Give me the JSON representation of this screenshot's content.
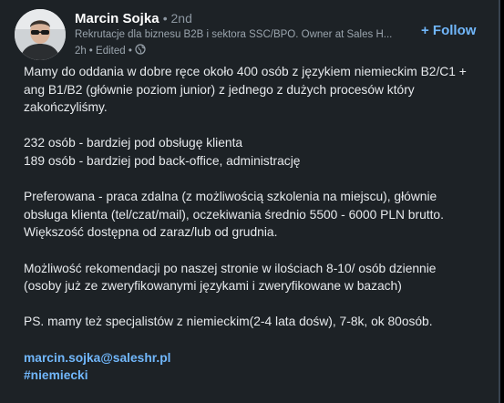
{
  "post": {
    "author": {
      "name": "Marcin Sojka",
      "degree": "• 2nd",
      "headline": "Rekrutacje dla biznesu B2B i sektora SSC/BPO. Owner at Sales H...",
      "time": "2h",
      "edited": "• Edited •",
      "visibility_icon": "globe-icon"
    },
    "follow_label": "+ Follow",
    "lines": {
      "p1_l1": "Mamy do oddania w dobre ręce około 400 osób z językiem niemieckim B2/C1 +",
      "p1_l2": "ang B1/B2 (głównie poziom junior) z jednego z dużych procesów który",
      "p1_l3": "zakończyliśmy.",
      "p2_l1": "232 osób - bardziej pod obsługę klienta",
      "p2_l2": "189 osób - bardziej pod back-office, administrację",
      "p3_l1": "Preferowana - praca zdalna (z możliwością szkolenia na miejscu), głównie",
      "p3_l2": "obsługa klienta (tel/czat/mail), oczekiwania średnio 5500 - 6000 PLN brutto.",
      "p3_l3": "Większość dostępna od zaraz/lub od grudnia.",
      "p4_l1": "Możliwość rekomendacji po naszej stronie w ilościach 8-10/ osób dziennie",
      "p4_l2": "(osoby już ze zweryfikowanymi językami i zweryfikowane w bazach)",
      "p5_l1": "PS. mamy też specjalistów z niemieckim(2-4 lata dośw), 7-8k, ok 80osób."
    },
    "email_link": "marcin.sojka@saleshr.pl",
    "hashtag": "#niemiecki"
  },
  "colors": {
    "background": "#1d2226",
    "text": "#e6e9ec",
    "muted": "#9aa4ad",
    "link": "#71b7fb"
  }
}
